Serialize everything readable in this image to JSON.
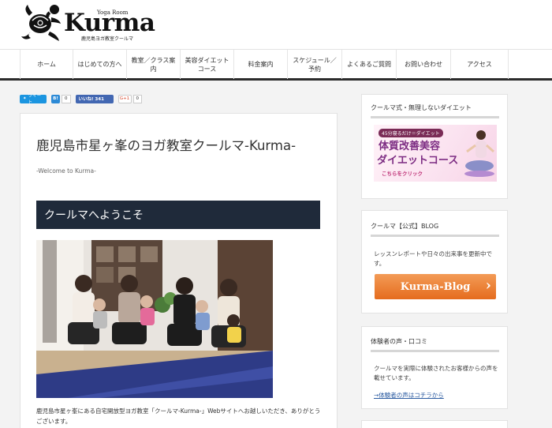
{
  "header": {
    "logo_sub": "Yoga Room",
    "logo_name": "Kurma",
    "logo_tagline": "鹿児島ヨガ教室クールマ"
  },
  "nav": {
    "items": [
      {
        "label": "ホーム"
      },
      {
        "label": "はじめての方へ"
      },
      {
        "label": "教室／クラス案内"
      },
      {
        "label": "美容ダイエットコース"
      },
      {
        "label": "料金案内"
      },
      {
        "label": "スケジュール／予約"
      },
      {
        "label": "よくあるご質問"
      },
      {
        "label": "お問い合わせ"
      },
      {
        "label": "アクセス"
      }
    ]
  },
  "share": {
    "tweet_label": "ツイート",
    "hatena_label": "B!",
    "hatena_count": "0",
    "like_label": "いいね! 341",
    "gplus_label": "G+1",
    "gplus_count": "0"
  },
  "main": {
    "title": "鹿児島市星ヶ峯のヨガ教室クールマ-Kurma-",
    "subtitle": "-Welcome to Kurma-",
    "section_heading": "クールマへようこそ",
    "body_text": "鹿児島市星ヶ峯にある自宅開放型ヨガ教室「クールマ-Kurma-」Webサイトへお越しいただき、ありがとうございます。"
  },
  "sidebar": {
    "diet": {
      "heading": "クールマ式・無理しないダイエット",
      "banner_top": "45分寝るだけ＝ダイエット",
      "banner_line1": "体質改善美容",
      "banner_line2": "ダイエットコース",
      "banner_cta": "こちらをクリック"
    },
    "blog": {
      "heading": "クールマ【公式】BLOG",
      "text": "レッスンレポートや日々の出来事を更新中です。",
      "button_label": "Kurma-Blog"
    },
    "voice": {
      "heading": "体験者の声・口コミ",
      "text": "クールマを実際に体験されたお客様からの声を載せています。",
      "link": "→体験者の声はコチラから"
    }
  },
  "colors": {
    "heading_bg": "#1f2a3a",
    "twitter": "#1b95e0",
    "facebook": "#4267b2",
    "blog_button": "#e8742b",
    "link": "#2a5aa0"
  }
}
